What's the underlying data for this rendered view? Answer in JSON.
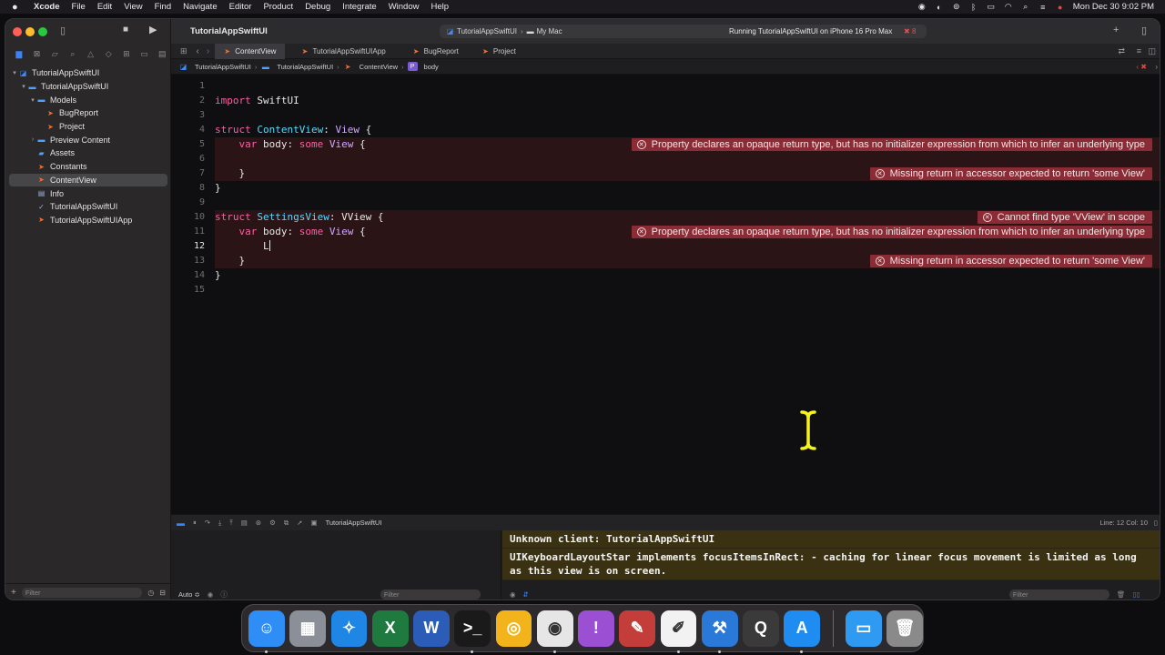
{
  "menubar": {
    "app_name": "Xcode",
    "menus": [
      "File",
      "Edit",
      "View",
      "Find",
      "Navigate",
      "Editor",
      "Product",
      "Debug",
      "Integrate",
      "Window",
      "Help"
    ],
    "clock": "Mon Dec 30  9:02 PM"
  },
  "toolbar": {
    "project_title": "TutorialAppSwiftUI",
    "scheme_name": "TutorialAppSwiftUI",
    "destination": "My Mac",
    "status": "Running TutorialAppSwiftUI on iPhone 16 Pro Max",
    "error_count": "8"
  },
  "tabs": [
    {
      "label": "ContentView",
      "active": true
    },
    {
      "label": "TutorialAppSwiftUIApp",
      "active": false
    },
    {
      "label": "BugReport",
      "active": false
    },
    {
      "label": "Project",
      "active": false
    }
  ],
  "jumpbar": [
    "TutorialAppSwiftUI",
    "TutorialAppSwiftUI",
    "ContentView",
    "body"
  ],
  "navigator": {
    "items": [
      {
        "label": "TutorialAppSwiftUI",
        "icon": "project-icon",
        "depth": 0,
        "disclosure": "▾"
      },
      {
        "label": "TutorialAppSwiftUI",
        "icon": "folder-icon",
        "depth": 1,
        "disclosure": "▾"
      },
      {
        "label": "Models",
        "icon": "folder-icon",
        "depth": 2,
        "disclosure": "▾"
      },
      {
        "label": "BugReport",
        "icon": "swift-file-icon",
        "depth": 3,
        "disclosure": ""
      },
      {
        "label": "Project",
        "icon": "swift-file-icon",
        "depth": 3,
        "disclosure": ""
      },
      {
        "label": "Preview Content",
        "icon": "folder-icon",
        "depth": 2,
        "disclosure": "›"
      },
      {
        "label": "Assets",
        "icon": "assets-icon",
        "depth": 2,
        "disclosure": ""
      },
      {
        "label": "Constants",
        "icon": "swift-file-icon",
        "depth": 2,
        "disclosure": ""
      },
      {
        "label": "ContentView",
        "icon": "swift-file-icon",
        "depth": 2,
        "disclosure": "",
        "selected": true
      },
      {
        "label": "Info",
        "icon": "plist-icon",
        "depth": 2,
        "disclosure": ""
      },
      {
        "label": "TutorialAppSwiftUI",
        "icon": "entitlements-icon",
        "depth": 2,
        "disclosure": ""
      },
      {
        "label": "TutorialAppSwiftUIApp",
        "icon": "swift-file-icon",
        "depth": 2,
        "disclosure": ""
      }
    ],
    "filter_placeholder": "Filter"
  },
  "editor": {
    "current_line": 12,
    "lines": [
      {
        "n": "1",
        "tokens": []
      },
      {
        "n": "2",
        "tokens": [
          {
            "t": "import",
            "c": "kw"
          },
          {
            "t": " SwiftUI",
            "c": "plain"
          }
        ]
      },
      {
        "n": "3",
        "tokens": []
      },
      {
        "n": "4",
        "tokens": [
          {
            "t": "struct",
            "c": "kw"
          },
          {
            "t": " ",
            "c": "plain"
          },
          {
            "t": "ContentView",
            "c": "typedecl"
          },
          {
            "t": ": ",
            "c": "plain"
          },
          {
            "t": "View",
            "c": "type"
          },
          {
            "t": " {",
            "c": "plain"
          }
        ]
      },
      {
        "n": "5",
        "tokens": [
          {
            "t": "    ",
            "c": "plain"
          },
          {
            "t": "var",
            "c": "kw"
          },
          {
            "t": " body: ",
            "c": "plain"
          },
          {
            "t": "some",
            "c": "kw"
          },
          {
            "t": " ",
            "c": "plain"
          },
          {
            "t": "View",
            "c": "type"
          },
          {
            "t": " {",
            "c": "plain"
          }
        ],
        "error": "Property declares an opaque return type, but has no initializer expression from which to infer an underlying type"
      },
      {
        "n": "6",
        "tokens": [],
        "error_bg": true
      },
      {
        "n": "7",
        "tokens": [
          {
            "t": "    }",
            "c": "plain"
          }
        ],
        "error": "Missing return in accessor expected to return 'some View'"
      },
      {
        "n": "8",
        "tokens": [
          {
            "t": "}",
            "c": "plain"
          }
        ]
      },
      {
        "n": "9",
        "tokens": []
      },
      {
        "n": "10",
        "tokens": [
          {
            "t": "struct",
            "c": "kw"
          },
          {
            "t": " ",
            "c": "plain"
          },
          {
            "t": "SettingsView",
            "c": "typedecl"
          },
          {
            "t": ": ",
            "c": "plain"
          },
          {
            "t": "VView",
            "c": "plain"
          },
          {
            "t": " {",
            "c": "plain"
          }
        ],
        "error": "Cannot find type 'VView' in scope"
      },
      {
        "n": "11",
        "tokens": [
          {
            "t": "    ",
            "c": "plain"
          },
          {
            "t": "var",
            "c": "kw"
          },
          {
            "t": " body: ",
            "c": "plain"
          },
          {
            "t": "some",
            "c": "kw"
          },
          {
            "t": " ",
            "c": "plain"
          },
          {
            "t": "View",
            "c": "type"
          },
          {
            "t": " {",
            "c": "plain"
          }
        ],
        "error": "Property declares an opaque return type, but has no initializer expression from which to infer an underlying type"
      },
      {
        "n": "12",
        "tokens": [
          {
            "t": "        L",
            "c": "plain"
          }
        ],
        "caret": true,
        "error_bg": true
      },
      {
        "n": "13",
        "tokens": [
          {
            "t": "    }",
            "c": "plain"
          }
        ],
        "error": "Missing return in accessor expected to return 'some View'"
      },
      {
        "n": "14",
        "tokens": [
          {
            "t": "}",
            "c": "plain"
          }
        ]
      },
      {
        "n": "15",
        "tokens": []
      }
    ]
  },
  "debugbar": {
    "target": "TutorialAppSwiftUI",
    "line_col": "Line: 12  Col: 10"
  },
  "variables": {
    "scope": "Auto ≎",
    "filter_placeholder": "Filter"
  },
  "console": {
    "lines": [
      "Unknown client: TutorialAppSwiftUI",
      "UIKeyboardLayoutStar implements focusItemsInRect: - caching for linear focus movement is limited as long as this view is on screen."
    ],
    "filter_placeholder": "Filter"
  },
  "dock": {
    "apps": [
      {
        "name": "finder",
        "glyph": "☺",
        "color": "#2f8ef5",
        "running": true
      },
      {
        "name": "launchpad",
        "glyph": "▦",
        "color": "#8a8f98",
        "running": false
      },
      {
        "name": "safari",
        "glyph": "✧",
        "color": "#1f86e6",
        "running": false
      },
      {
        "name": "excel",
        "glyph": "X",
        "color": "#1f7a3f",
        "running": false
      },
      {
        "name": "word",
        "glyph": "W",
        "color": "#2b5cb8",
        "running": false
      },
      {
        "name": "terminal",
        "glyph": ">_",
        "color": "#1a1a1a",
        "running": true
      },
      {
        "name": "chrome-canary",
        "glyph": "◎",
        "color": "#f3b41b",
        "running": false
      },
      {
        "name": "chrome",
        "glyph": "◉",
        "color": "#e6e6e6",
        "running": true
      },
      {
        "name": "feedback",
        "glyph": "!",
        "color": "#9b4fd3",
        "running": false
      },
      {
        "name": "sketch-pad",
        "glyph": "✎",
        "color": "#c33d3a",
        "running": false
      },
      {
        "name": "textedit",
        "glyph": "✐",
        "color": "#f2f2f2",
        "running": true
      },
      {
        "name": "xcode",
        "glyph": "⚒",
        "color": "#2a78d8",
        "running": true
      },
      {
        "name": "quicktime",
        "glyph": "Q",
        "color": "#3a3a3a",
        "running": false
      },
      {
        "name": "app-store",
        "glyph": "A",
        "color": "#1e8cf0",
        "running": true
      },
      {
        "name": "downloads",
        "glyph": "▭",
        "color": "#2f9af2",
        "running": false
      },
      {
        "name": "trash",
        "glyph": "🗑",
        "color": "#8a8a8a",
        "running": false
      }
    ]
  }
}
